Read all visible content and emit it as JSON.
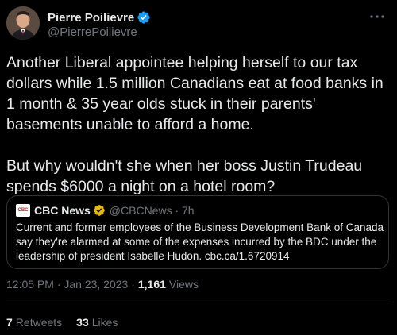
{
  "author": {
    "display_name": "Pierre Poilievre",
    "handle": "@PierrePoilievre"
  },
  "tweet": {
    "text": "Another Liberal appointee helping herself to our tax dollars while 1.5 million Canadians eat at food banks in 1 month & 35 year olds stuck in their parents' basements unable to afford a home.\n\nBut why wouldn't she when her boss Justin Trudeau spends $6000 a night on a hotel room?"
  },
  "quoted_tweet": {
    "logo_text": "CBC",
    "display_name": "CBC News",
    "handle_and_time": "@CBCNews · 7h",
    "text": "Current and former employees of the Business Development Bank of Canada say they're alarmed at some of the expenses incurred by the BDC under the leadership of president Isabelle Hudon. cbc.ca/1.6720914"
  },
  "meta": {
    "timestamp": "12:05 PM · Jan 23, 2023 ·",
    "views_count": "1,161",
    "views_label": "Views"
  },
  "stats": {
    "retweets_count": "7",
    "retweets_label": "Retweets",
    "likes_count": "33",
    "likes_label": "Likes"
  },
  "colors": {
    "background": "#000000",
    "text": "#e7e9ea",
    "secondary_text": "#71767b",
    "border": "#2f3336",
    "verified_blue": "#1d9bf0",
    "verified_gold": "#e2b719",
    "cbc_red": "#c1272d"
  },
  "icons": {
    "verified": "verified-badge-icon",
    "more": "more-options-icon"
  }
}
